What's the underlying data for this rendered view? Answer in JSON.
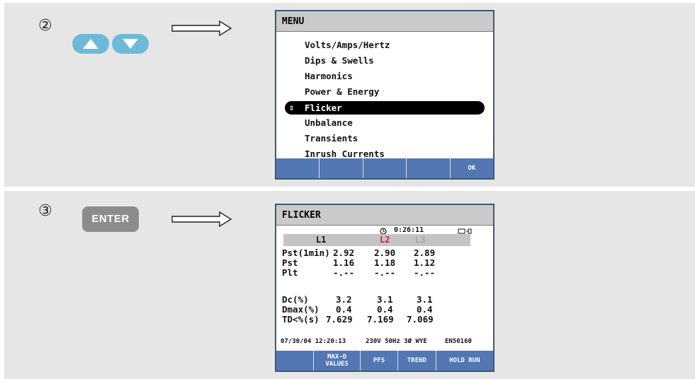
{
  "steps": [
    {
      "number": "②",
      "menu_screen": {
        "title": "MENU",
        "items": [
          "Volts/Amps/Hertz",
          "Dips & Swells",
          "Harmonics",
          "Power & Energy",
          "Flicker",
          "Unbalance",
          "Transients",
          "Inrush Currents"
        ],
        "selected_item": "Flicker",
        "selected_marker": "⇕",
        "softkeys": [
          "",
          "",
          "",
          "",
          "OK"
        ]
      }
    },
    {
      "number": "③",
      "enter_label": "ENTER",
      "flicker_screen": {
        "title": "FLICKER",
        "timer": "0:26:11",
        "phases": [
          {
            "label": "L1",
            "color": "#111111"
          },
          {
            "label": "L2",
            "color": "#e02020"
          },
          {
            "label": "L3",
            "color": "#9a9a9a"
          }
        ],
        "rows1": [
          {
            "label": "Pst(1min)",
            "values": [
              "2.92",
              "2.90",
              "2.89"
            ]
          },
          {
            "label": "Pst",
            "values": [
              "1.16",
              "1.18",
              "1.12"
            ]
          },
          {
            "label": "Plt",
            "values": [
              "-.--",
              "-.--",
              "-.--"
            ]
          }
        ],
        "rows2": [
          {
            "label": "Dc(%)",
            "values": [
              "3.2",
              "3.1",
              "3.1"
            ]
          },
          {
            "label": "Dmax(%)",
            "values": [
              "0.4",
              "0.4",
              "0.4"
            ]
          },
          {
            "label": "TD<%(s)",
            "values": [
              "7.629",
              "7.169",
              "7.069"
            ]
          }
        ],
        "status": {
          "datetime": "07/30/04 12:20:13",
          "config": "230V 50Hz 3Ø WYE",
          "standard": "EN50160"
        },
        "softkeys": [
          "",
          "MAX-D VALUES",
          "PFS",
          "TREND",
          "HOLD RUN"
        ]
      }
    }
  ],
  "icons": {
    "up": "up-arrow-icon",
    "down": "down-arrow-icon",
    "arrow": "right-arrow-icon",
    "clock": "clock-icon",
    "battery": "battery-plug-icon"
  },
  "colors": {
    "panel_bg": "#e6e6e6",
    "nav_button": "#6dbad8",
    "softkey": "#5277b3",
    "screen_border": "#3c5a78"
  }
}
